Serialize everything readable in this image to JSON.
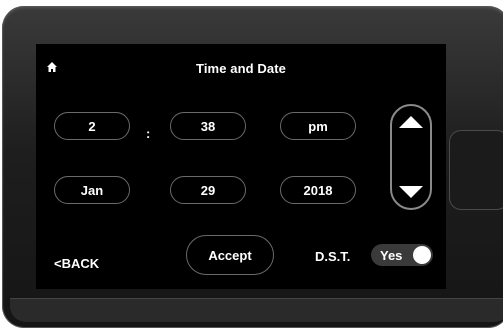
{
  "screen": {
    "title": "Time and Date"
  },
  "time": {
    "hour": "2",
    "separator": ":",
    "minute": "38",
    "period": "pm"
  },
  "date": {
    "month": "Jan",
    "day": "29",
    "year": "2018"
  },
  "footer": {
    "back_label": "<BACK",
    "accept_label": "Accept",
    "dst_label": "D.S.T.",
    "dst_value": "Yes",
    "dst_enabled": true
  },
  "icons": {
    "home": "home-icon",
    "up": "arrow-up-icon",
    "down": "arrow-down-icon"
  }
}
